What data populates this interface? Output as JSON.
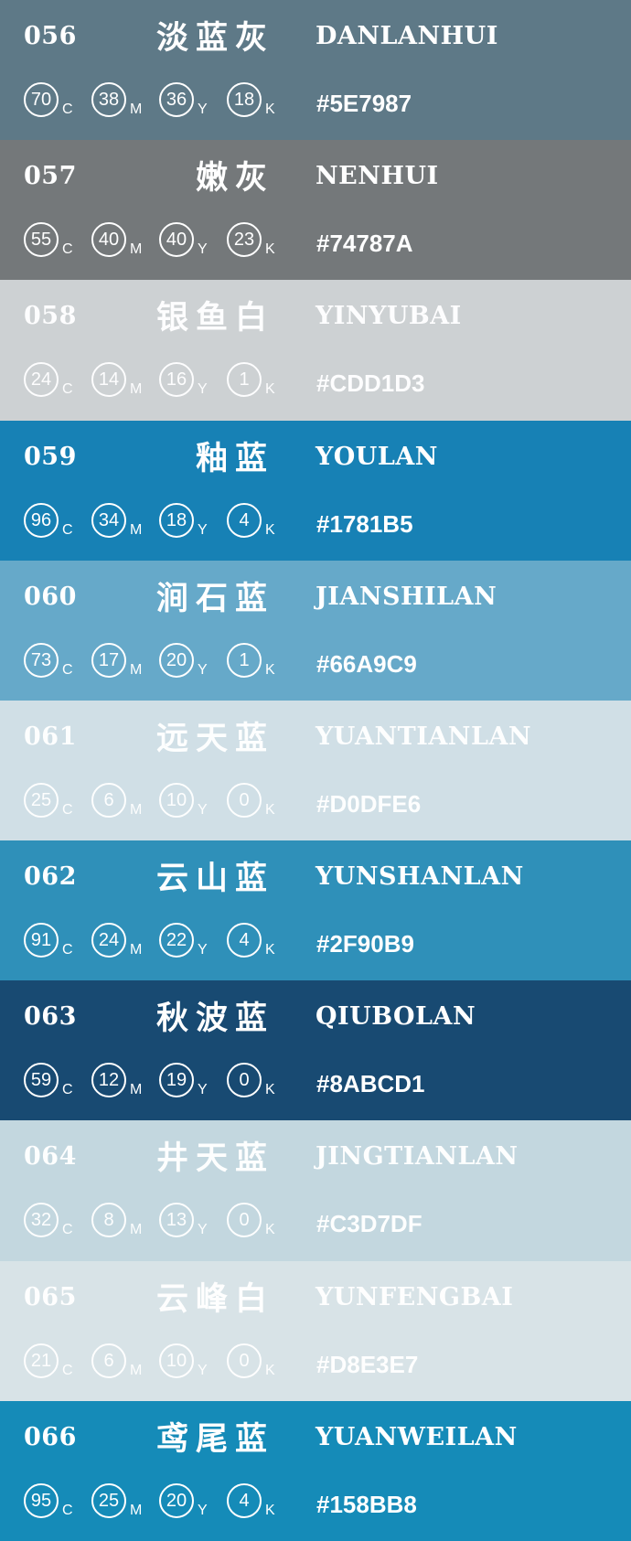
{
  "swatches": [
    {
      "num": "056",
      "cn": "淡蓝灰",
      "py": "DANLANHUI",
      "c": "70",
      "m": "38",
      "y": "36",
      "k": "18",
      "hex": "#5E7987",
      "bg": "#5e7987",
      "light": false
    },
    {
      "num": "057",
      "cn": "嫩灰",
      "py": "NENHUI",
      "c": "55",
      "m": "40",
      "y": "40",
      "k": "23",
      "hex": "#74787A",
      "bg": "#74787a",
      "light": false
    },
    {
      "num": "058",
      "cn": "银鱼白",
      "py": "YINYUBAI",
      "c": "24",
      "m": "14",
      "y": "16",
      "k": "1",
      "hex": "#CDD1D3",
      "bg": "#cdd1d3",
      "light": true
    },
    {
      "num": "059",
      "cn": "釉蓝",
      "py": "YOULAN",
      "c": "96",
      "m": "34",
      "y": "18",
      "k": "4",
      "hex": "#1781B5",
      "bg": "#1781b5",
      "light": false
    },
    {
      "num": "060",
      "cn": "涧石蓝",
      "py": "JIANSHILAN",
      "c": "73",
      "m": "17",
      "y": "20",
      "k": "1",
      "hex": "#66A9C9",
      "bg": "#66a9c9",
      "light": false
    },
    {
      "num": "061",
      "cn": "远天蓝",
      "py": "YUANTIANLAN",
      "c": "25",
      "m": "6",
      "y": "10",
      "k": "0",
      "hex": "#D0DFE6",
      "bg": "#d0dfe6",
      "light": true
    },
    {
      "num": "062",
      "cn": "云山蓝",
      "py": "YUNSHANLAN",
      "c": "91",
      "m": "24",
      "y": "22",
      "k": "4",
      "hex": "#2F90B9",
      "bg": "#2f90b9",
      "light": false
    },
    {
      "num": "063",
      "cn": "秋波蓝",
      "py": "QIUBOLAN",
      "c": "59",
      "m": "12",
      "y": "19",
      "k": "0",
      "hex": "#8ABCD1",
      "bg": "#184a72",
      "light": false
    },
    {
      "num": "064",
      "cn": "井天蓝",
      "py": "JINGTIANLAN",
      "c": "32",
      "m": "8",
      "y": "13",
      "k": "0",
      "hex": "#C3D7DF",
      "bg": "#c3d7df",
      "light": true
    },
    {
      "num": "065",
      "cn": "云峰白",
      "py": "YUNFENGBAI",
      "c": "21",
      "m": "6",
      "y": "10",
      "k": "0",
      "hex": "#D8E3E7",
      "bg": "#d8e3e7",
      "light": true
    },
    {
      "num": "066",
      "cn": "鸢尾蓝",
      "py": "YUANWEILAN",
      "c": "95",
      "m": "25",
      "y": "20",
      "k": "4",
      "hex": "#158BB8",
      "bg": "#158bb8",
      "light": false
    }
  ],
  "labels": {
    "c": "C",
    "m": "M",
    "y": "Y",
    "k": "K"
  }
}
